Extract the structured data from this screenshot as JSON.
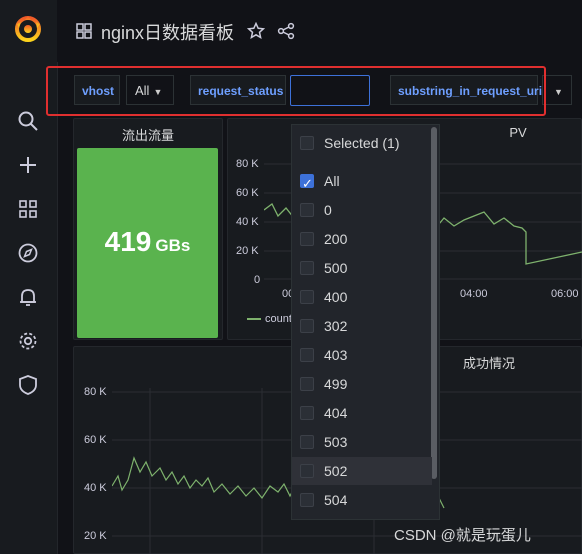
{
  "app": {
    "title": "nginx日数据看板"
  },
  "sidebar": {
    "items": [
      "search-icon",
      "plus-icon",
      "dashboards-icon",
      "explore-icon",
      "alerting-icon",
      "settings-icon",
      "shield-icon"
    ]
  },
  "variables": {
    "vhost_label": "vhost",
    "vhost_value": "All",
    "request_status_label": "request_status",
    "request_status_value": "",
    "substring_label": "substring_in_request_uri"
  },
  "panels": {
    "outflow": {
      "title": "流出流量",
      "value": "419",
      "unit": "GBs",
      "color": "#5ab34e"
    },
    "pv": {
      "title": "PV",
      "y_ticks": [
        "80 K",
        "60 K",
        "40 K",
        "20 K",
        "0"
      ],
      "x_ticks": [
        "00",
        "04:00",
        "06:00"
      ],
      "legend": "count"
    },
    "status": {
      "title": "成功情况",
      "y_ticks": [
        "80 K",
        "60 K",
        "40 K",
        "20 K"
      ]
    }
  },
  "dropdown": {
    "header": "Selected (1)",
    "options": [
      {
        "label": "All",
        "checked": true
      },
      {
        "label": "0",
        "checked": false
      },
      {
        "label": "200",
        "checked": false
      },
      {
        "label": "500",
        "checked": false
      },
      {
        "label": "400",
        "checked": false
      },
      {
        "label": "302",
        "checked": false
      },
      {
        "label": "403",
        "checked": false
      },
      {
        "label": "499",
        "checked": false
      },
      {
        "label": "404",
        "checked": false
      },
      {
        "label": "503",
        "checked": false
      },
      {
        "label": "502",
        "checked": false
      },
      {
        "label": "504",
        "checked": false
      }
    ]
  },
  "watermark": "CSDN @就是玩蛋儿",
  "colors": {
    "accent": "#3d71d9",
    "series": "#7eb26d",
    "highlight": "#e02f2f"
  }
}
